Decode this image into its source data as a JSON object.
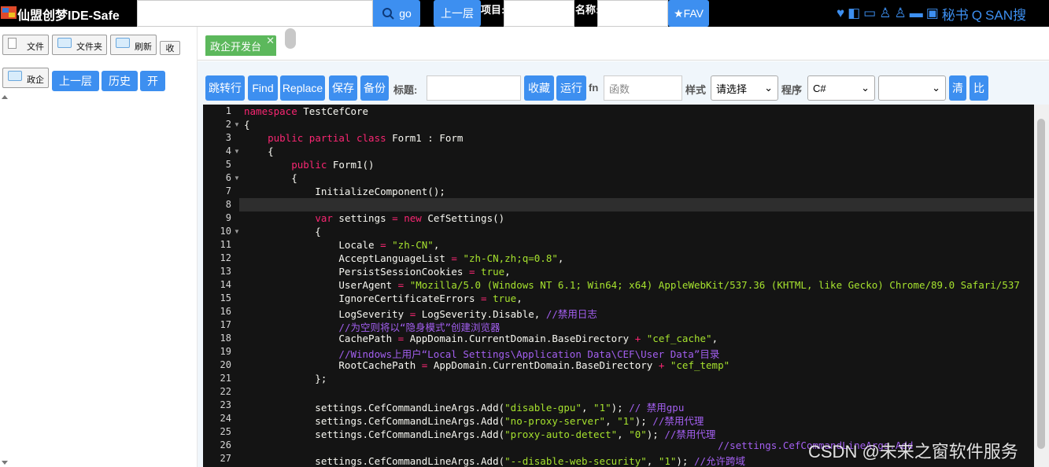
{
  "topbar": {
    "app_title": "仙盟创梦IDE-Safe",
    "search_button": "go",
    "up_button": "上一层",
    "project_label": "项目:",
    "name_label": "名称:",
    "fav_button": "★FAV",
    "secretary": "秘书",
    "san_search": "SAN搜"
  },
  "left": {
    "file_button": "文件",
    "folder_button": "文件夹",
    "refresh_button": "刷新",
    "collapse_button": "收",
    "gov_button": "政企",
    "up_button": "上一层",
    "history_button": "历史",
    "open_button": "开"
  },
  "tabs": [
    {
      "label": "政企开发台",
      "close": "✕"
    }
  ],
  "toolbar": {
    "goto_button": "跳转行",
    "find_button": "Find",
    "replace_button": "Replace",
    "save_button": "保存",
    "backup_button": "备份",
    "title_label": "标题:",
    "favorite_button": "收藏",
    "run_button": "运行",
    "fn_label": "fn",
    "function_placeholder": "函数",
    "style_label": "样式",
    "style_select": "请选择",
    "program_label": "程序",
    "program_select": "C#",
    "clear_button": "清",
    "compare_button": "比"
  },
  "code_lines": [
    {
      "n": "1",
      "segs": [
        [
          "kw",
          "namespace"
        ],
        [
          "tp",
          " TestCefCore"
        ]
      ]
    },
    {
      "n": "2",
      "segs": [
        [
          "tp",
          "{"
        ]
      ],
      "fold": true
    },
    {
      "n": "3",
      "segs": [
        [
          "tp",
          "    "
        ],
        [
          "kw",
          "public partial class"
        ],
        [
          "tp",
          " Form1 : Form"
        ]
      ]
    },
    {
      "n": "4",
      "segs": [
        [
          "tp",
          "    {"
        ]
      ],
      "fold": true
    },
    {
      "n": "5",
      "segs": [
        [
          "tp",
          "        "
        ],
        [
          "kw",
          "public"
        ],
        [
          "tp",
          " Form1()"
        ]
      ]
    },
    {
      "n": "6",
      "segs": [
        [
          "tp",
          "        {"
        ]
      ],
      "fold": true
    },
    {
      "n": "7",
      "segs": [
        [
          "tp",
          "            InitializeComponent();"
        ]
      ]
    },
    {
      "n": "8",
      "segs": [
        [
          "tp",
          ""
        ]
      ]
    },
    {
      "n": "9",
      "segs": [
        [
          "tp",
          "            "
        ],
        [
          "kw",
          "var"
        ],
        [
          "tp",
          " settings "
        ],
        [
          "kw",
          "="
        ],
        [
          "tp",
          " "
        ],
        [
          "kw",
          "new"
        ],
        [
          "tp",
          " CefSettings()"
        ]
      ]
    },
    {
      "n": "10",
      "segs": [
        [
          "tp",
          "            {"
        ]
      ],
      "fold": true
    },
    {
      "n": "11",
      "segs": [
        [
          "tp",
          "                Locale "
        ],
        [
          "kw",
          "="
        ],
        [
          "tp",
          " "
        ],
        [
          "st",
          "\"zh-CN\""
        ],
        [
          "tp",
          ","
        ]
      ]
    },
    {
      "n": "12",
      "segs": [
        [
          "tp",
          "                AcceptLanguageList "
        ],
        [
          "kw",
          "="
        ],
        [
          "tp",
          " "
        ],
        [
          "st",
          "\"zh-CN,zh;q=0.8\""
        ],
        [
          "tp",
          ","
        ]
      ]
    },
    {
      "n": "13",
      "segs": [
        [
          "tp",
          "                PersistSessionCookies "
        ],
        [
          "kw",
          "="
        ],
        [
          "tp",
          " "
        ],
        [
          "st",
          "true"
        ],
        [
          "tp",
          ","
        ]
      ]
    },
    {
      "n": "14",
      "segs": [
        [
          "tp",
          "                UserAgent "
        ],
        [
          "kw",
          "="
        ],
        [
          "tp",
          " "
        ],
        [
          "st",
          "\"Mozilla/5.0 (Windows NT 6.1; Win64; x64) AppleWebKit/537.36 (KHTML, like Gecko) Chrome/89.0 Safari/537"
        ]
      ]
    },
    {
      "n": "15",
      "segs": [
        [
          "tp",
          "                IgnoreCertificateErrors "
        ],
        [
          "kw",
          "="
        ],
        [
          "tp",
          " "
        ],
        [
          "st",
          "true"
        ],
        [
          "tp",
          ","
        ]
      ]
    },
    {
      "n": "16",
      "segs": [
        [
          "tp",
          "                LogSeverity "
        ],
        [
          "kw",
          "="
        ],
        [
          "tp",
          " LogSeverity.Disable, "
        ],
        [
          "cm",
          "//禁用日志"
        ]
      ]
    },
    {
      "n": "17",
      "segs": [
        [
          "tp",
          "                "
        ],
        [
          "cm",
          "//为空则将以“隐身模式”创建浏览器"
        ]
      ]
    },
    {
      "n": "18",
      "segs": [
        [
          "tp",
          "                CachePath "
        ],
        [
          "kw",
          "="
        ],
        [
          "tp",
          " AppDomain.CurrentDomain.BaseDirectory "
        ],
        [
          "kw",
          "+"
        ],
        [
          "tp",
          " "
        ],
        [
          "st",
          "\"cef_cache\""
        ],
        [
          "tp",
          ","
        ]
      ]
    },
    {
      "n": "19",
      "segs": [
        [
          "tp",
          "                "
        ],
        [
          "cm",
          "//Windows上用户“Local Settings\\Application Data\\CEF\\User Data”目录"
        ]
      ]
    },
    {
      "n": "20",
      "segs": [
        [
          "tp",
          "                RootCachePath "
        ],
        [
          "kw",
          "="
        ],
        [
          "tp",
          " AppDomain.CurrentDomain.BaseDirectory "
        ],
        [
          "kw",
          "+"
        ],
        [
          "tp",
          " "
        ],
        [
          "st",
          "\"cef_temp\""
        ]
      ]
    },
    {
      "n": "21",
      "segs": [
        [
          "tp",
          "            };"
        ]
      ]
    },
    {
      "n": "22",
      "segs": [
        [
          "tp",
          ""
        ]
      ]
    },
    {
      "n": "23",
      "segs": [
        [
          "tp",
          "            settings.CefCommandLineArgs.Add("
        ],
        [
          "st",
          "\"disable-gpu\""
        ],
        [
          "tp",
          ", "
        ],
        [
          "st",
          "\"1\""
        ],
        [
          "tp",
          "); "
        ],
        [
          "cm",
          "// 禁用gpu"
        ]
      ]
    },
    {
      "n": "24",
      "segs": [
        [
          "tp",
          "            settings.CefCommandLineArgs.Add("
        ],
        [
          "st",
          "\"no-proxy-server\""
        ],
        [
          "tp",
          ", "
        ],
        [
          "st",
          "\"1\""
        ],
        [
          "tp",
          "); "
        ],
        [
          "cm",
          "//禁用代理"
        ]
      ]
    },
    {
      "n": "25",
      "segs": [
        [
          "tp",
          "            settings.CefCommandLineArgs.Add("
        ],
        [
          "st",
          "\"proxy-auto-detect\""
        ],
        [
          "tp",
          ", "
        ],
        [
          "st",
          "\"0\""
        ],
        [
          "tp",
          "); "
        ],
        [
          "cm",
          "//禁用代理"
        ]
      ]
    },
    {
      "n": "26",
      "segs": [
        [
          "tp",
          "                                                                                "
        ],
        [
          "cm",
          "//settings.CefCommandLineArgs.Add"
        ]
      ]
    },
    {
      "n": "27",
      "segs": [
        [
          "tp",
          "            settings.CefCommandLineArgs.Add("
        ],
        [
          "st",
          "\"--disable-web-security\""
        ],
        [
          "tp",
          ", "
        ],
        [
          "st",
          "\"1\""
        ],
        [
          "tp",
          "); "
        ],
        [
          "cm",
          "//允许跨域"
        ]
      ]
    }
  ],
  "watermark": "CSDN @未来之窗软件服务"
}
